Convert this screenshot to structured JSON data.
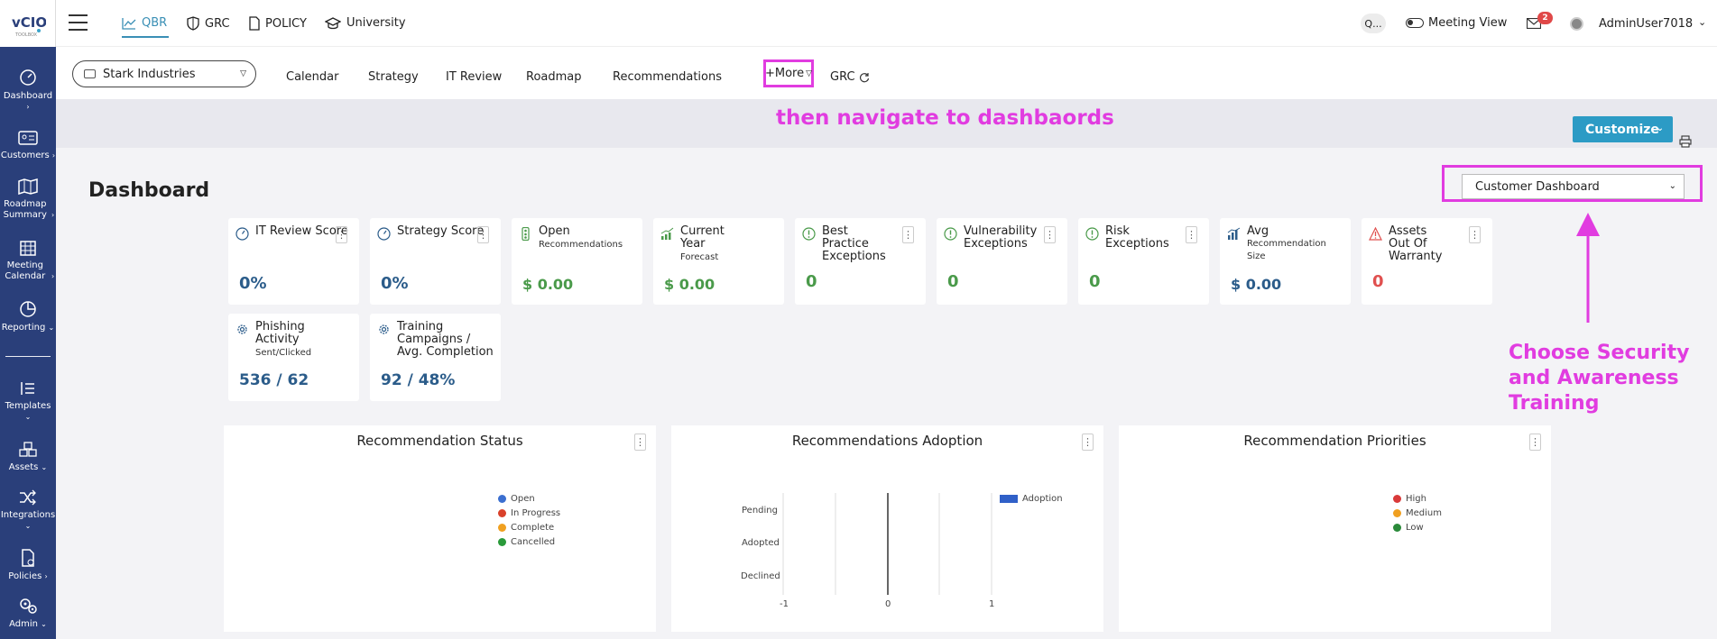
{
  "app": {
    "logo_text": "vCIO",
    "logo_sub": "TOOLBOX",
    "username": "AdminUser7018",
    "notification_count": "2",
    "meeting_view_label": "Meeting View",
    "search_label": "Q..."
  },
  "sidebar": {
    "items": [
      {
        "label": "Dashboard",
        "icon": "gauge-icon"
      },
      {
        "label": "Customers",
        "icon": "id-card-icon"
      },
      {
        "label": "Roadmap Summary",
        "icon": "map-icon"
      },
      {
        "label": "Meeting Calendar",
        "icon": "calendar-icon"
      },
      {
        "label": "Reporting",
        "icon": "pie-chart-icon"
      },
      {
        "label": "Templates",
        "icon": "list-icon"
      },
      {
        "label": "Assets",
        "icon": "boxes-icon"
      },
      {
        "label": "Integrations",
        "icon": "shuffle-icon"
      },
      {
        "label": "Policies",
        "icon": "policy-icon"
      },
      {
        "label": "Admin",
        "icon": "gears-icon"
      }
    ]
  },
  "topnav": {
    "items": [
      {
        "label": "QBR",
        "icon": "chart-line-icon",
        "active": true
      },
      {
        "label": "GRC",
        "icon": "shield-icon",
        "active": false
      },
      {
        "label": "POLICY",
        "icon": "document-icon",
        "active": false
      },
      {
        "label": "University",
        "icon": "graduation-cap-icon",
        "active": false
      }
    ]
  },
  "subnav": {
    "company": "Stark Industries",
    "items": [
      "Calendar",
      "Strategy",
      "IT Review",
      "Roadmap",
      "Recommendations"
    ],
    "more_label": "+More",
    "grc_label": "GRC"
  },
  "toolbar": {
    "customize_label": "Customize"
  },
  "annotations": {
    "navigate": "then navigate to dashbaords",
    "choose": "Choose Security and Awareness Training",
    "color": "#e13ce0"
  },
  "dashboard": {
    "title": "Dashboard",
    "selector_value": "Customer Dashboard",
    "cards": [
      {
        "title": "IT Review Score",
        "sub": "",
        "value": "0%",
        "tone": "blue",
        "icon": "gauge-icon"
      },
      {
        "title": "Strategy Score",
        "sub": "",
        "value": "0%",
        "tone": "blue",
        "icon": "gauge-icon"
      },
      {
        "title": "Open",
        "sub": "Recommendations",
        "value": "$ 0.00",
        "tone": "green",
        "icon": "traffic-light-icon"
      },
      {
        "title": "Current Year",
        "sub": "Forecast",
        "value": "$ 0.00",
        "tone": "green",
        "icon": "bar-growth-icon"
      },
      {
        "title": "Best Practice Exceptions",
        "sub": "",
        "value": "0",
        "tone": "green",
        "icon": "alert-circle-icon"
      },
      {
        "title": "Vulnerability Exceptions",
        "sub": "",
        "value": "0",
        "tone": "green",
        "icon": "alert-circle-icon"
      },
      {
        "title": "Risk Exceptions",
        "sub": "",
        "value": "0",
        "tone": "green",
        "icon": "alert-circle-icon"
      },
      {
        "title": "Avg",
        "sub": "Recommendation Size",
        "value": "$ 0.00",
        "tone": "blue",
        "icon": "bar-chart-icon"
      },
      {
        "title": "Assets Out Of Warranty",
        "sub": "",
        "value": "0",
        "tone": "red",
        "icon": "warning-triangle-icon"
      },
      {
        "title": "Phishing Activity",
        "sub": "Sent/Clicked",
        "value": "536 / 62",
        "tone": "blue",
        "icon": "gear-icon"
      },
      {
        "title": "Training Campaigns / Avg. Completion",
        "sub": "",
        "value": "92 / 48%",
        "tone": "blue",
        "icon": "gear-icon"
      }
    ],
    "panels": [
      {
        "title": "Recommendation Status",
        "legend": [
          {
            "label": "Open",
            "color": "#3b6fd0"
          },
          {
            "label": "In Progress",
            "color": "#d9412a"
          },
          {
            "label": "Complete",
            "color": "#f0a020"
          },
          {
            "label": "Cancelled",
            "color": "#2a9a3a"
          }
        ]
      },
      {
        "title": "Recommendations Adoption",
        "legend": [
          {
            "label": "Adoption",
            "color": "#3060c8"
          }
        ],
        "y_categories": [
          "Pending",
          "Adopted",
          "Declined"
        ],
        "x_ticks": [
          "-1",
          "0",
          "1"
        ]
      },
      {
        "title": "Recommendation Priorities",
        "legend": [
          {
            "label": "High",
            "color": "#d93a3a"
          },
          {
            "label": "Medium",
            "color": "#f0a020"
          },
          {
            "label": "Low",
            "color": "#2a8a3a"
          }
        ]
      }
    ]
  }
}
